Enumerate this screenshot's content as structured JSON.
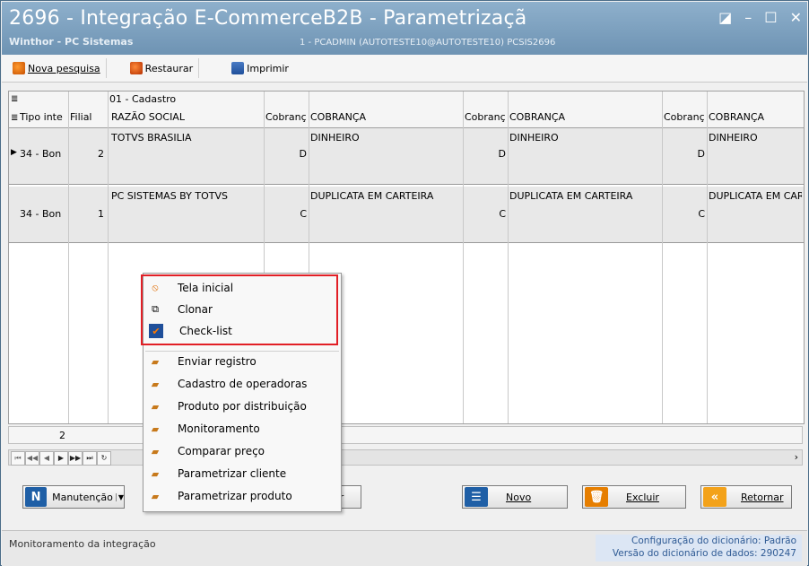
{
  "window": {
    "title": "2696 - Integração E-CommerceB2B - Parametrizaçã",
    "app_name": "Winthor - PC Sistemas",
    "session": "1 - PCADMIN (AUTOTESTE10@AUTOTESTE10)  PCSIS2696"
  },
  "toolbar": {
    "new_search": "Nova pesquisa",
    "restore": "Restaurar",
    "print": "Imprimir"
  },
  "grid": {
    "band_label": "01 - Cadastro",
    "headers": [
      "Tipo inte",
      "Filial",
      "RAZÃO SOCIAL",
      "Cobranç",
      "COBRANÇA",
      "Cobranç",
      "COBRANÇA",
      "Cobranç",
      "COBRANÇA"
    ],
    "rows": [
      {
        "tipo": "34 - Bon",
        "filial": "2",
        "razao": "TOTVS BRASILIA",
        "c1": "D",
        "cob1": "DINHEIRO",
        "c2": "D",
        "cob2": "DINHEIRO",
        "c3": "D",
        "cob3": "DINHEIRO"
      },
      {
        "tipo": "34 - Bon",
        "filial": "1",
        "razao": "PC SISTEMAS BY TOTVS",
        "c1": "C",
        "cob1": "DUPLICATA EM CARTEIRA",
        "c2": "C",
        "cob2": "DUPLICATA EM CARTEIRA",
        "c3": "C",
        "cob3": "DUPLICATA EM CART"
      }
    ],
    "record_count": "2"
  },
  "menu": {
    "items": [
      "Tela inicial",
      "Clonar",
      "Check-list",
      "Enviar registro",
      "Cadastro de operadoras",
      "Produto por distribuição",
      "Monitoramento",
      "Comparar preço",
      "Parametrizar cliente",
      "Parametrizar produto"
    ]
  },
  "buttons": {
    "manutencao": "Manutenção",
    "partial": "ar",
    "novo": "Novo",
    "excluir": "Excluir",
    "retornar": "Retornar"
  },
  "status": {
    "left": "Monitoramento da integração",
    "dict_config": "Configuração do dicionário: Padrão",
    "dict_version": "Versão do dicionário de dados: 290247"
  },
  "colors": {
    "highlight": "#e21f26",
    "titlebar": "#7a9dbd",
    "status_text": "#2e5a94"
  }
}
